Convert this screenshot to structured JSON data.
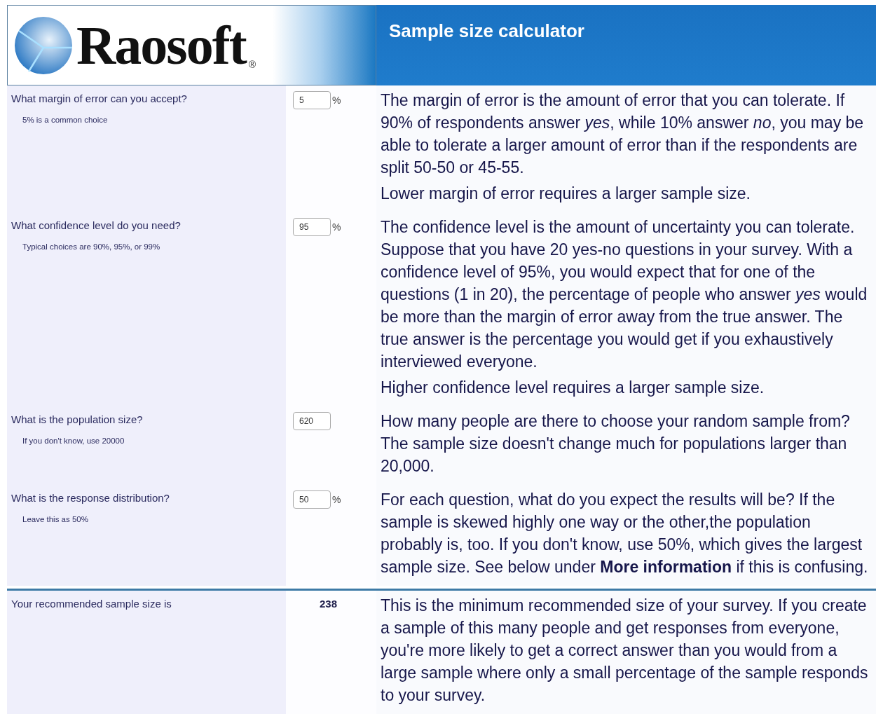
{
  "header": {
    "logo": {
      "text": "Raosoft",
      "mark": "®"
    },
    "title": "Sample size calculator"
  },
  "questions": [
    {
      "label": "What margin of error can you accept?",
      "hint": "5% is a common choice",
      "value": "5",
      "unit": "%",
      "paragraphs": [
        "The margin of error is the amount of error that you can tolerate. If 90% of respondents answer *yes*, while 10% answer *no*, you may be able to tolerate a larger amount of error than if the respondents are split 50-50 or 45-55.",
        "Lower margin of error requires a larger sample size."
      ]
    },
    {
      "label": "What confidence level do you need?",
      "hint": "Typical choices are 90%, 95%, or 99%",
      "value": "95",
      "unit": "%",
      "paragraphs": [
        "The confidence level is the amount of uncertainty you can tolerate. Suppose that you have 20 yes-no questions in your survey. With a confidence level of 95%, you would expect that for one of the questions (1 in 20), the percentage of people who answer *yes* would be more than the margin of error away from the true answer. The true answer is the percentage you would get if you exhaustively interviewed everyone.",
        "Higher confidence level requires a larger sample size."
      ]
    },
    {
      "label": "What is the population size?",
      "hint": "If you don't know, use 20000",
      "value": "620",
      "paragraphs": [
        "How many people are there to choose your random sample from? The sample size doesn't change much for populations larger than 20,000."
      ]
    },
    {
      "label": "What is the response distribution?",
      "hint": "Leave this as 50%",
      "value": "50",
      "unit": "%",
      "paragraphs": [
        "For each question, what do you expect the results will be? If the sample is skewed highly one way or the other,the population probably is, too. If you don't know, use 50%, which gives the largest sample size. See below under **More information** if this is confusing."
      ]
    }
  ],
  "result": {
    "label": "Your recommended sample size is",
    "value": "238",
    "paragraphs": [
      "This is the minimum recommended size of your survey. If you create a sample of this many people and get responses from everyone, you're more likely to get a correct answer than you would from a large sample where only a small percentage of the sample responds to your survey."
    ]
  }
}
